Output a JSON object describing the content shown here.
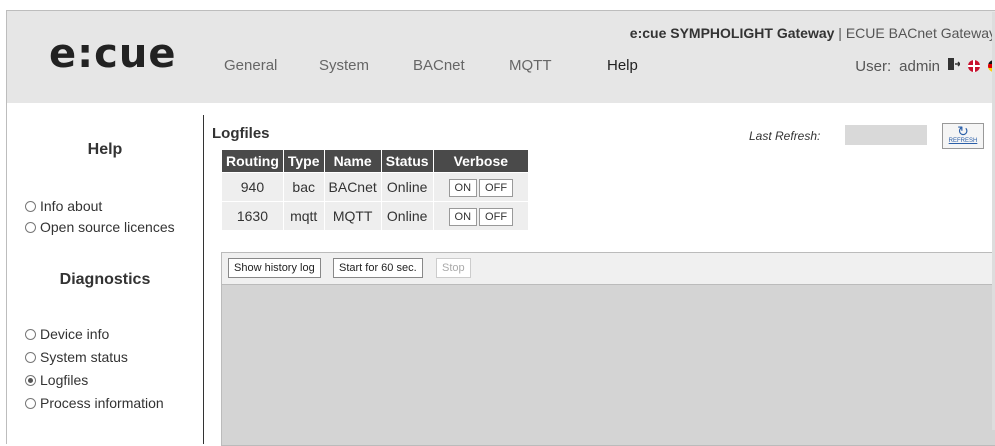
{
  "header": {
    "logo": "e:cue",
    "nav": [
      "General",
      "System",
      "BACnet",
      "MQTT",
      "Help"
    ],
    "active_nav": "Help",
    "product_bold": "e:cue SYMPHOLIGHT Gateway",
    "product_rest": " | ECUE BACnet Gateway",
    "user_label": "User:",
    "user_name": "admin"
  },
  "sidebar": {
    "help_title": "Help",
    "help_items": [
      {
        "label": "Info about",
        "checked": false
      },
      {
        "label": "Open source licences",
        "checked": false
      }
    ],
    "diag_title": "Diagnostics",
    "diag_items": [
      {
        "label": "Device info",
        "checked": false
      },
      {
        "label": "System status",
        "checked": false
      },
      {
        "label": "Logfiles",
        "checked": true
      },
      {
        "label": "Process information",
        "checked": false
      }
    ]
  },
  "main": {
    "title": "Logfiles",
    "last_refresh_label": "Last Refresh:",
    "refresh_button": "REFRESH",
    "table": {
      "headers": [
        "Routing",
        "Type",
        "Name",
        "Status",
        "Verbose"
      ],
      "rows": [
        {
          "routing": "940",
          "type": "bac",
          "name": "BACnet",
          "status": "Online"
        },
        {
          "routing": "1630",
          "type": "mqtt",
          "name": "MQTT",
          "status": "Online"
        }
      ],
      "on_label": "ON",
      "off_label": "OFF"
    },
    "toolbar": {
      "show_history": "Show history log",
      "start": "Start for 60 sec.",
      "stop": "Stop"
    }
  }
}
